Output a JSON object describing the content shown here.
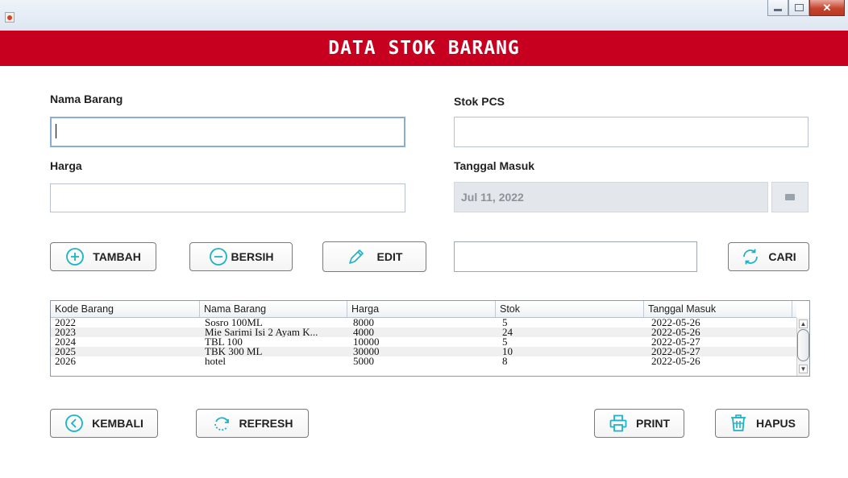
{
  "header": {
    "title": "DATA STOK BARANG"
  },
  "form": {
    "nama_barang_label": "Nama Barang",
    "stok_pcs_label": "Stok PCS",
    "harga_label": "Harga",
    "tanggal_masuk_label": "Tanggal Masuk",
    "nama_barang_value": "",
    "stok_pcs_value": "",
    "harga_value": "",
    "tanggal_masuk_value": "Jul 11, 2022"
  },
  "buttons": {
    "tambah": "TAMBAH",
    "bersih": "BERSIH",
    "edit": "EDIT",
    "cari": "CARI",
    "kembali": "KEMBALI",
    "refresh": "REFRESH",
    "print": "PRINT",
    "hapus": "HAPUS"
  },
  "search": {
    "value": ""
  },
  "table": {
    "columns": [
      "Kode Barang",
      "Nama Barang",
      "Harga",
      "Stok",
      "Tanggal Masuk"
    ],
    "rows": [
      [
        "2022",
        "Sosro 100ML",
        "8000",
        "5",
        "2022-05-26"
      ],
      [
        "2023",
        "Mie Sarimi Isi 2 Ayam K...",
        "4000",
        "24",
        "2022-05-26"
      ],
      [
        "2024",
        "TBL 100",
        "10000",
        "5",
        "2022-05-27"
      ],
      [
        "2025",
        "TBK 300 ML",
        "30000",
        "10",
        "2022-05-27"
      ],
      [
        "2026",
        "hotel",
        "5000",
        "8",
        "2022-05-26"
      ]
    ]
  },
  "colors": {
    "header_bg": "#c8001f",
    "icon_accent": "#1bb3c9"
  },
  "icons": {
    "tambah": "plus-circle-icon",
    "bersih": "minus-circle-icon",
    "edit": "pencil-icon",
    "cari": "search-refresh-icon",
    "kembali": "back-arrow-circle-icon",
    "refresh": "refresh-icon",
    "print": "printer-icon",
    "hapus": "trash-icon"
  }
}
